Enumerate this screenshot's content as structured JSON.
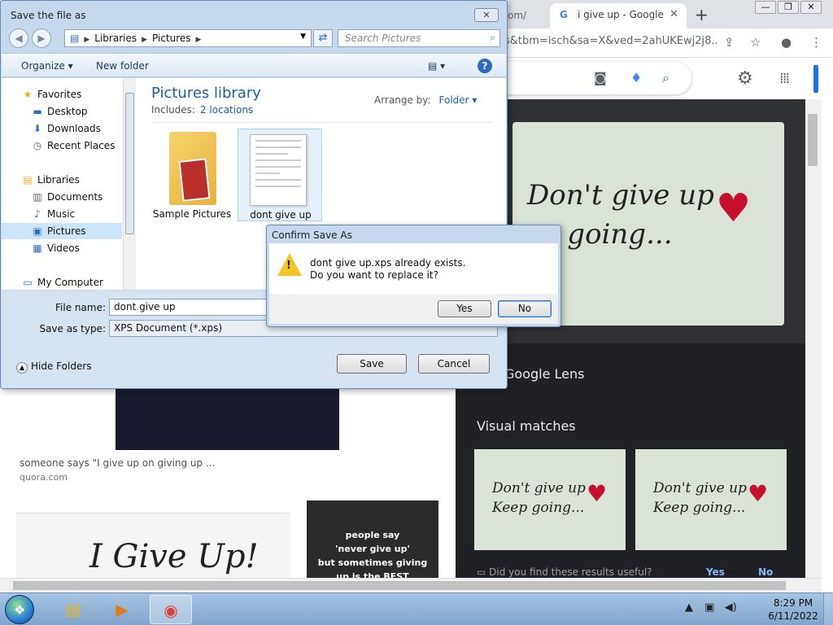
{
  "browser": {
    "tab_prev_label": "om/",
    "tab_active_label": "i give up - Google",
    "tab_close": "✕",
    "new_tab": "+",
    "url": "s&tbm=isch&sa=X&ved=2ahUKEwj2j8...",
    "google_lens_label": "Google Lens",
    "visual_matches_label": "Visual matches",
    "feedback_question": "Did you find these results useful?",
    "feedback_yes": "Yes",
    "feedback_no": "No",
    "lens_image_text_line1": "Don't give up",
    "lens_image_text_line2": "Keep going...",
    "vm_text_line1": "Don't give up",
    "vm_text_line2": "Keep going...",
    "result_caption": "someone says \"I give up on giving up ...",
    "result_site": "quora.com",
    "paper_text": "I Give Up!",
    "black_img_line1": "people say",
    "black_img_line2": "'never give up'",
    "black_img_line3": "but sometimes giving",
    "black_img_line4": "up is the BEST"
  },
  "save_dialog": {
    "title": "Save the file as",
    "close": "✕",
    "path": [
      "Libraries",
      "Pictures"
    ],
    "search_placeholder": "Search Pictures",
    "organize": "Organize ▾",
    "new_folder": "New folder",
    "tree": [
      {
        "label": "Favorites",
        "icon": "star-icon",
        "glyph": "★"
      },
      {
        "label": "Desktop",
        "icon": "desktop-icon",
        "glyph": "▬"
      },
      {
        "label": "Downloads",
        "icon": "downloads-icon",
        "glyph": "⬇"
      },
      {
        "label": "Recent Places",
        "icon": "recent-places-icon",
        "glyph": "◷"
      },
      {
        "label": "Libraries",
        "icon": "libraries-icon",
        "glyph": "▤"
      },
      {
        "label": "Documents",
        "icon": "documents-icon",
        "glyph": "▥"
      },
      {
        "label": "Music",
        "icon": "music-icon",
        "glyph": "♪"
      },
      {
        "label": "Pictures",
        "icon": "pictures-icon",
        "glyph": "▣"
      },
      {
        "label": "Videos",
        "icon": "videos-icon",
        "glyph": "▦"
      },
      {
        "label": "My Computer",
        "icon": "computer-icon",
        "glyph": "▭"
      }
    ],
    "library_title": "Pictures library",
    "includes_label": "Includes:",
    "includes_link": "2 locations",
    "arrange_by_label": "Arrange by:",
    "arrange_by_value": "Folder ▾",
    "files": [
      {
        "label": "Sample Pictures"
      },
      {
        "label": "dont give up"
      }
    ],
    "file_name_label": "File name:",
    "file_name_value": "dont give up",
    "save_as_type_label": "Save as type:",
    "save_as_type_value": "XPS Document (*.xps)",
    "hide_folders": "Hide Folders",
    "save_button": "Save",
    "cancel_button": "Cancel"
  },
  "confirm_dialog": {
    "title": "Confirm Save As",
    "message_line1": "dont give up.xps already exists.",
    "message_line2": "Do you want to replace it?",
    "yes_button": "Yes",
    "no_button": "No"
  },
  "taskbar": {
    "time": "8:29 PM",
    "date": "6/11/2022"
  },
  "colors": {
    "accent": "#2e6bc4",
    "lens_panel": "#202124",
    "heart": "#c8102e"
  }
}
